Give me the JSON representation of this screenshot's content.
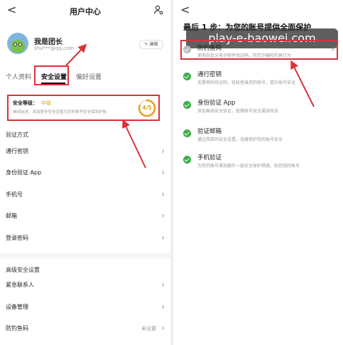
{
  "left": {
    "header": {
      "back": "<",
      "title": "用户中心"
    },
    "profile": {
      "name": "我是团长",
      "email": "shu***@qq.com",
      "edit_label": "编辑"
    },
    "tabs": [
      "个人资料",
      "安全设置",
      "偏好设置"
    ],
    "security_card": {
      "label": "安全等级：",
      "level": "中级",
      "description": "继续前进，添加更多安全设置为您的账号安全保驾护航",
      "progress_text": "4/5",
      "progress_fraction": 0.8
    },
    "verification_section": {
      "title": "验证方式",
      "items": [
        "通行密钥",
        "身份验证 App",
        "手机号",
        "邮箱",
        "登录密码"
      ]
    },
    "advanced_section": {
      "title": "高级安全设置",
      "items": [
        {
          "label": "紧急联系人",
          "value": ""
        },
        {
          "label": "设备管理",
          "value": ""
        },
        {
          "label": "防钓鱼码",
          "value": "未设置"
        }
      ]
    }
  },
  "right": {
    "back": "<",
    "heading": "最后 1 步：为您的账号提供全面保护",
    "watermark": "play-e-baowei.com",
    "items": [
      {
        "title": "防钓鱼码",
        "desc": "使用自定义电子邮件验证码，防范诈骗和钓鱼行为",
        "status": "pending"
      },
      {
        "title": "通行密钥",
        "desc": "无需密码验证码，轻松登录您的账号，提升账号安全",
        "status": "done"
      },
      {
        "title": "身份验证 App",
        "desc": "添加离线安全验证，抵御账号安全漏洞攻击",
        "status": "done"
      },
      {
        "title": "验证邮箱",
        "desc": "通过简单的安全设置，无缝保护您的账号安全",
        "status": "done"
      },
      {
        "title": "手机验证",
        "desc": "为您的账号增加额外一层安全保护措施，助您找回账号",
        "status": "done"
      }
    ]
  },
  "colors": {
    "highlight": "#d9333b",
    "accent": "#e0a21b",
    "success": "#3dae49"
  },
  "icons": {
    "user_settings": "user-gear-icon",
    "edit": "pencil-icon",
    "chevron": "chevron-right-icon",
    "arrow": "red-arrow-annotation"
  }
}
